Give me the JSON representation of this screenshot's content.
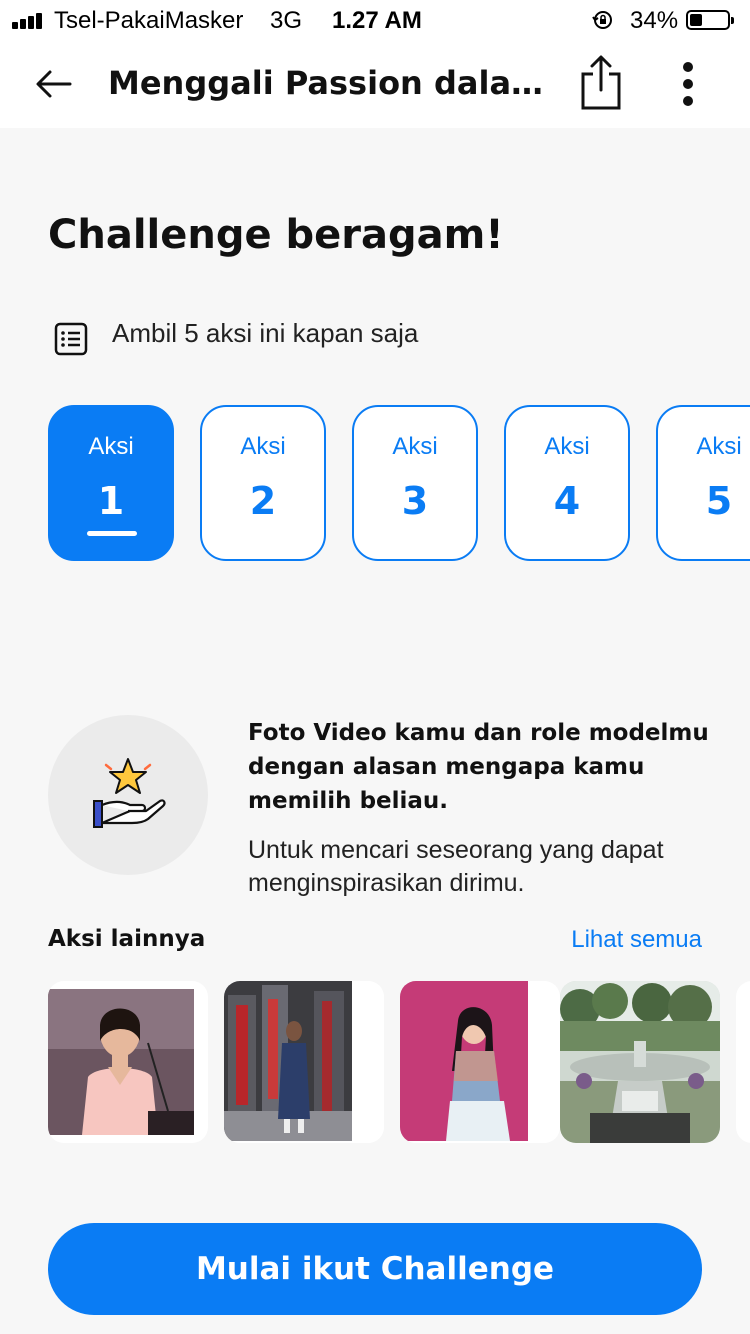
{
  "status_bar": {
    "carrier": "Tsel-PakaiMasker",
    "network": "3G",
    "time": "1.27 AM",
    "battery_percent": "34%",
    "battery_level": 0.34
  },
  "header": {
    "back_icon": "arrow-left-icon",
    "title": "Menggali Passion dalam Diri",
    "share_icon": "share-icon",
    "more_icon": "more-vertical-icon"
  },
  "challenge": {
    "heading": "Challenge beragam!",
    "info_icon": "list-icon",
    "info_text": "Ambil 5 aksi ini kapan saja",
    "aksi": [
      {
        "label": "Aksi",
        "number": "1",
        "active": true
      },
      {
        "label": "Aksi",
        "number": "2",
        "active": false
      },
      {
        "label": "Aksi",
        "number": "3",
        "active": false
      },
      {
        "label": "Aksi",
        "number": "4",
        "active": false
      },
      {
        "label": "Aksi",
        "number": "5",
        "active": false
      }
    ]
  },
  "task": {
    "icon": "hand-star-icon",
    "title": "Foto  Video kamu dan role modelmu dengan alasan mengapa kamu memilih beliau.",
    "description": "Untuk mencari seseorang yang dapat menginspirasikan dirimu."
  },
  "other_actions": {
    "label": "Aksi lainnya",
    "see_all": "Lihat semua",
    "thumbnails": [
      "woman-at-podium-photo",
      "woman-in-denim-dress-photo",
      "woman-pink-wall-photo",
      "park-fountain-photo"
    ]
  },
  "cta": {
    "label": "Mulai ikut Challenge"
  },
  "colors": {
    "accent": "#0a7cf4",
    "background": "#f7f7f7",
    "text": "#111111"
  }
}
